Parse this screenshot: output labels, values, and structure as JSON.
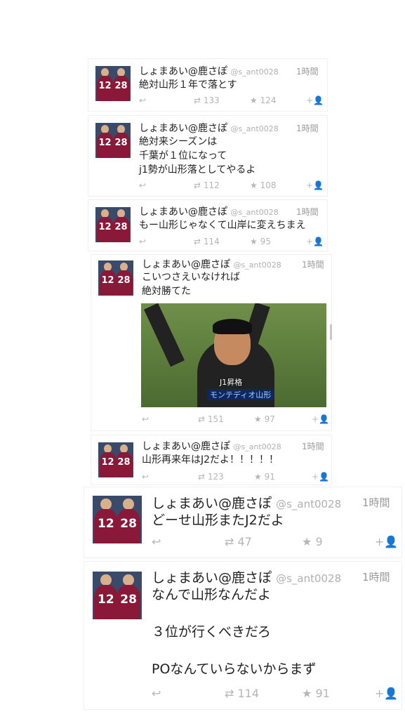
{
  "tweets": [
    {
      "name": "しょまあい@鹿さぽ",
      "handle": "@s_ant0028",
      "time": "1時間",
      "text": "絶対山形１年で落とす",
      "retweets": "133",
      "likes": "124",
      "avatar_numbers": [
        "12",
        "28"
      ]
    },
    {
      "name": "しょまあい@鹿さぽ",
      "handle": "@s_ant0028",
      "time": "1時間",
      "text": "絶対来シーズンは\n千葉が１位になって\nj1勢が山形落としてやるよ",
      "retweets": "112",
      "likes": "108",
      "avatar_numbers": [
        "12",
        "28"
      ]
    },
    {
      "name": "しょまあい@鹿さぽ",
      "handle": "@s_ant0028",
      "time": "1時間",
      "text": "もー山形じゃなくて山岸に変えちまえ",
      "retweets": "114",
      "likes": "95",
      "avatar_numbers": [
        "12",
        "28"
      ]
    },
    {
      "name": "しょまあい@鹿さぽ",
      "handle": "@s_ant0028",
      "time": "1時間",
      "text": "こいつさえいなければ\n絶対勝てた",
      "retweets": "151",
      "likes": "97",
      "avatar_numbers": [
        "12",
        "28"
      ],
      "image_caption_top": "J1昇格",
      "image_caption_bottom": "モンテディオ山形"
    },
    {
      "name": "しょまあい@鹿さぽ",
      "handle": "@s_ant0028",
      "time": "1時間",
      "text": "山形再来年はJ2だよ！！！！！",
      "retweets": "123",
      "likes": "91",
      "avatar_numbers": [
        "12",
        "28"
      ]
    },
    {
      "name": "しょまあい@鹿さぽ",
      "handle": "@s_ant0028",
      "time": "1時間",
      "text": "どーせ山形またJ2だよ",
      "retweets": "47",
      "likes": "9",
      "avatar_numbers": [
        "12",
        "28"
      ]
    },
    {
      "name": "しょまあい@鹿さぽ",
      "handle": "@s_ant0028",
      "time": "1時間",
      "text": "なんで山形なんだよ\n\n３位が行くべきだろ\n\nPOなんていらないからまず",
      "retweets": "114",
      "likes": "91",
      "avatar_numbers": [
        "12",
        "28"
      ]
    }
  ],
  "icons": {
    "reply": "reply-icon",
    "retweet": "retweet-icon",
    "like": "star-icon",
    "follow": "follow-icon"
  },
  "colors": {
    "text": "#222222",
    "meta": "#9a9a9a",
    "action": "#b5b5b5",
    "jersey": "#8a1838"
  }
}
